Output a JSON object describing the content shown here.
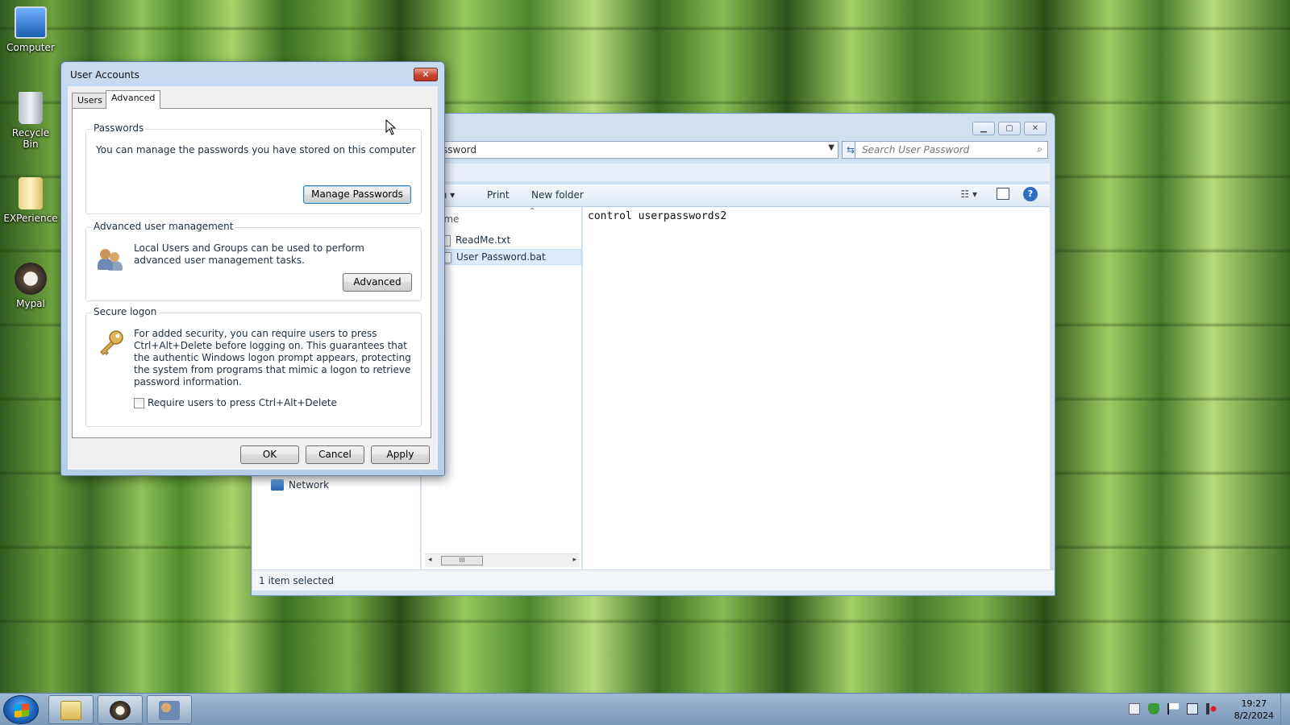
{
  "desktop": {
    "icons": [
      {
        "label": "Computer",
        "icon": "computer-icon"
      },
      {
        "label": "Recycle Bin",
        "icon": "recycle-bin-icon"
      },
      {
        "label": "EXPerience",
        "icon": "folder-icon"
      },
      {
        "label": "Mypal",
        "icon": "mypal-browser-icon"
      }
    ]
  },
  "explorer": {
    "address_fragment": "ssword",
    "search_placeholder": "Search User Password",
    "toolbar": {
      "partial_item": "th",
      "print_label": "Print",
      "new_folder_label": "New folder"
    },
    "column_header": "ame",
    "files": [
      {
        "name": "ReadMe.txt",
        "selected": false
      },
      {
        "name": "User Password.bat",
        "selected": true
      }
    ],
    "nav": {
      "network_label": "Network"
    },
    "preview_text": "control userpasswords2",
    "status": "1 item selected"
  },
  "dialog": {
    "title": "User Accounts",
    "close_glyph": "✕",
    "tabs": [
      {
        "label": "Users",
        "active": false
      },
      {
        "label": "Advanced",
        "active": true
      }
    ],
    "passwords": {
      "heading": "Passwords",
      "description": "You can manage the passwords you have stored on this computer",
      "button": "Manage Passwords"
    },
    "advanced_mgmt": {
      "heading": "Advanced user management",
      "description": "Local Users and Groups can be used to perform advanced user management tasks.",
      "button": "Advanced"
    },
    "secure_logon": {
      "heading": "Secure logon",
      "description": "For added security, you can require users to press Ctrl+Alt+Delete before logging on. This guarantees that the authentic Windows logon prompt appears, protecting the system from programs that mimic a logon to retrieve password information.",
      "checkbox_label": "Require users to press Ctrl+Alt+Delete",
      "checkbox_checked": false
    },
    "buttons": {
      "ok": "OK",
      "cancel": "Cancel",
      "apply": "Apply"
    }
  },
  "taskbar": {
    "apps": [
      "windows-explorer-icon",
      "mypal-browser-icon",
      "user-accounts-icon"
    ],
    "time": "19:27",
    "date": "8/2/2024"
  },
  "colors": {
    "accent": "#3c7fb1",
    "window_frame": "#c6daf0",
    "taskbar": "#8aa6c4"
  }
}
